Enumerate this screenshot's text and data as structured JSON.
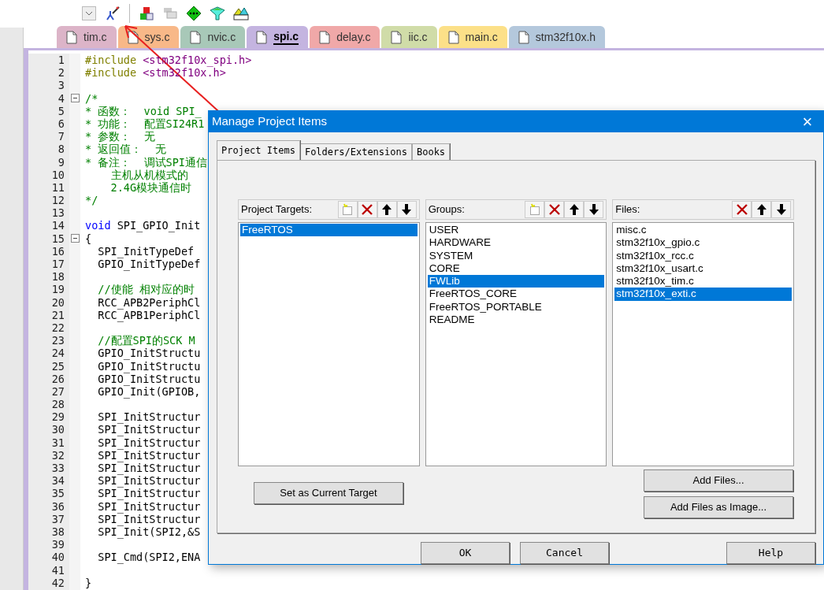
{
  "file_tabs": [
    {
      "label": "tim.c",
      "color": "#dcb4c8",
      "selected": false
    },
    {
      "label": "sys.c",
      "color": "#f8b888",
      "selected": false
    },
    {
      "label": "nvic.c",
      "color": "#a8c8b8",
      "selected": false
    },
    {
      "label": "spi.c",
      "color": "#c4b4e0",
      "selected": true
    },
    {
      "label": "delay.c",
      "color": "#f0a8a8",
      "selected": false
    },
    {
      "label": "iic.c",
      "color": "#d0dca8",
      "selected": false
    },
    {
      "label": "main.c",
      "color": "#fce088",
      "selected": false
    },
    {
      "label": "stm32f10x.h",
      "color": "#b4c8dc",
      "selected": false
    }
  ],
  "code_lines": [
    {
      "n": "1",
      "parts": [
        {
          "kind": "pre",
          "text": "#include "
        },
        {
          "kind": "hdr",
          "text": "<stm32f10x_spi.h>"
        }
      ]
    },
    {
      "n": "2",
      "parts": [
        {
          "kind": "pre",
          "text": "#include "
        },
        {
          "kind": "hdr",
          "text": "<stm32f10x.h>"
        }
      ]
    },
    {
      "n": "3"
    },
    {
      "n": "4",
      "fold": true,
      "parts": [
        {
          "kind": "cmt",
          "text": "/*"
        }
      ]
    },
    {
      "n": "5",
      "parts": [
        {
          "kind": "cmt",
          "text": "* 函数：  void SPI_"
        }
      ]
    },
    {
      "n": "6",
      "parts": [
        {
          "kind": "cmt",
          "text": "* 功能：  配置SI24R1"
        }
      ]
    },
    {
      "n": "7",
      "parts": [
        {
          "kind": "cmt",
          "text": "* 参数：  无"
        }
      ]
    },
    {
      "n": "8",
      "parts": [
        {
          "kind": "cmt",
          "text": "* 返回值：  无"
        }
      ]
    },
    {
      "n": "9",
      "parts": [
        {
          "kind": "cmt",
          "text": "* 备注：  调试SPI通信"
        }
      ]
    },
    {
      "n": "10",
      "parts": [
        {
          "kind": "cmt",
          "text": "    主机从机模式的"
        }
      ]
    },
    {
      "n": "11",
      "parts": [
        {
          "kind": "cmt",
          "text": "    2.4G模块通信时"
        }
      ]
    },
    {
      "n": "12",
      "parts": [
        {
          "kind": "cmt",
          "text": "*/"
        }
      ]
    },
    {
      "n": "13"
    },
    {
      "n": "14",
      "parts": [
        {
          "kind": "kw",
          "text": "void"
        },
        {
          "kind": "txt",
          "text": " SPI_GPIO_Init"
        }
      ]
    },
    {
      "n": "15",
      "fold": true,
      "parts": [
        {
          "kind": "txt",
          "text": "{"
        }
      ]
    },
    {
      "n": "16",
      "parts": [
        {
          "kind": "txt",
          "text": "  SPI_InitTypeDef"
        }
      ]
    },
    {
      "n": "17",
      "parts": [
        {
          "kind": "txt",
          "text": "  GPIO_InitTypeDef"
        }
      ]
    },
    {
      "n": "18"
    },
    {
      "n": "19",
      "parts": [
        {
          "kind": "cmt",
          "text": "  //使能 相对应的时"
        }
      ]
    },
    {
      "n": "20",
      "parts": [
        {
          "kind": "txt",
          "text": "  RCC_APB2PeriphCl"
        }
      ]
    },
    {
      "n": "21",
      "parts": [
        {
          "kind": "txt",
          "text": "  RCC_APB1PeriphCl"
        }
      ]
    },
    {
      "n": "22"
    },
    {
      "n": "23",
      "parts": [
        {
          "kind": "cmt",
          "text": "  //配置SPI的SCK M"
        }
      ]
    },
    {
      "n": "24",
      "parts": [
        {
          "kind": "txt",
          "text": "  GPIO_InitStructu"
        }
      ]
    },
    {
      "n": "25",
      "parts": [
        {
          "kind": "txt",
          "text": "  GPIO_InitStructu"
        }
      ]
    },
    {
      "n": "26",
      "parts": [
        {
          "kind": "txt",
          "text": "  GPIO_InitStructu"
        }
      ]
    },
    {
      "n": "27",
      "parts": [
        {
          "kind": "txt",
          "text": "  GPIO_Init(GPIOB,"
        }
      ]
    },
    {
      "n": "28"
    },
    {
      "n": "29",
      "parts": [
        {
          "kind": "txt",
          "text": "  SPI_InitStructur"
        }
      ]
    },
    {
      "n": "30",
      "parts": [
        {
          "kind": "txt",
          "text": "  SPI_InitStructur"
        }
      ]
    },
    {
      "n": "31",
      "parts": [
        {
          "kind": "txt",
          "text": "  SPI_InitStructur"
        }
      ]
    },
    {
      "n": "32",
      "parts": [
        {
          "kind": "txt",
          "text": "  SPI_InitStructur"
        }
      ]
    },
    {
      "n": "33",
      "parts": [
        {
          "kind": "txt",
          "text": "  SPI_InitStructur"
        }
      ]
    },
    {
      "n": "34",
      "parts": [
        {
          "kind": "txt",
          "text": "  SPI_InitStructur"
        }
      ]
    },
    {
      "n": "35",
      "parts": [
        {
          "kind": "txt",
          "text": "  SPI_InitStructur"
        }
      ]
    },
    {
      "n": "36",
      "parts": [
        {
          "kind": "txt",
          "text": "  SPI_InitStructur"
        }
      ]
    },
    {
      "n": "37",
      "parts": [
        {
          "kind": "txt",
          "text": "  SPI_InitStructur"
        }
      ]
    },
    {
      "n": "38",
      "parts": [
        {
          "kind": "txt",
          "text": "  SPI_Init(SPI2,&S"
        }
      ]
    },
    {
      "n": "39"
    },
    {
      "n": "40",
      "parts": [
        {
          "kind": "txt",
          "text": "  SPI_Cmd(SPI2,ENA"
        }
      ]
    },
    {
      "n": "41"
    },
    {
      "n": "42",
      "parts": [
        {
          "kind": "txt",
          "text": "}"
        }
      ]
    }
  ],
  "dialog": {
    "title": "Manage Project Items",
    "close": "×",
    "tabs": [
      {
        "label": "Project Items",
        "selected": true
      },
      {
        "label": "Folders/Extensions",
        "selected": false
      },
      {
        "label": "Books",
        "selected": false
      }
    ],
    "lists": [
      {
        "label": "Project Targets:",
        "new_button": true,
        "items": [
          {
            "text": "FreeRTOS",
            "selected": true
          }
        ]
      },
      {
        "label": "Groups:",
        "new_button": true,
        "items": [
          {
            "text": "USER",
            "selected": false
          },
          {
            "text": "HARDWARE",
            "selected": false
          },
          {
            "text": "SYSTEM",
            "selected": false
          },
          {
            "text": "CORE",
            "selected": false
          },
          {
            "text": "FWLib",
            "selected": true
          },
          {
            "text": "FreeRTOS_CORE",
            "selected": false
          },
          {
            "text": "FreeRTOS_PORTABLE",
            "selected": false
          },
          {
            "text": "README",
            "selected": false
          }
        ]
      },
      {
        "label": "Files:",
        "new_button": false,
        "items": [
          {
            "text": "misc.c",
            "selected": false
          },
          {
            "text": "stm32f10x_gpio.c",
            "selected": false
          },
          {
            "text": "stm32f10x_rcc.c",
            "selected": false
          },
          {
            "text": "stm32f10x_usart.c",
            "selected": false
          },
          {
            "text": "stm32f10x_tim.c",
            "selected": false
          },
          {
            "text": "stm32f10x_exti.c",
            "selected": true
          }
        ]
      }
    ],
    "set_target_button": "Set as Current Target",
    "add_files_button": "Add Files...",
    "add_image_button": "Add Files as Image...",
    "ok_button": "OK",
    "cancel_button": "Cancel",
    "help_button": "Help"
  }
}
